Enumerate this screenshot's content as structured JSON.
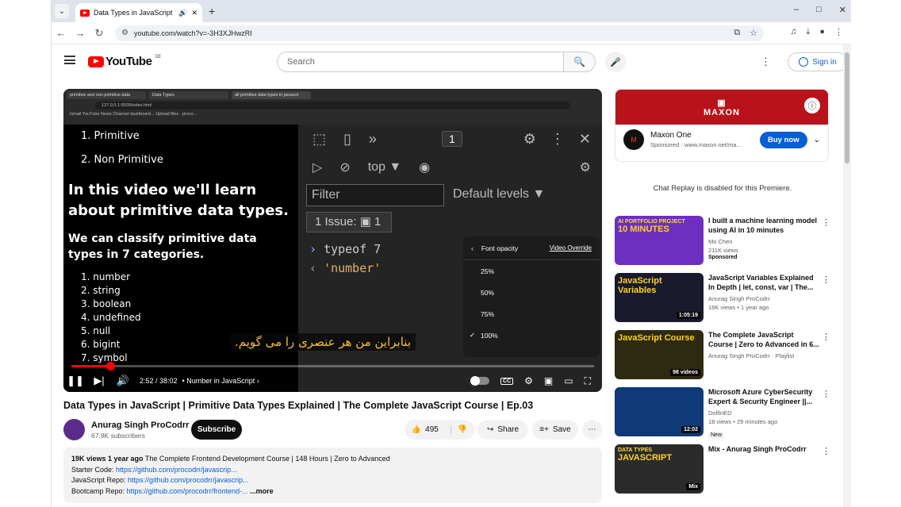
{
  "browser": {
    "tab_title": "Data Types in JavaScript | Pr",
    "url": "youtube.com/watch?v=-3H3XJHwzRI",
    "newtab": "+",
    "win": [
      "–",
      "□",
      "✕"
    ]
  },
  "header": {
    "logo": "YouTube",
    "region": "DE",
    "search_placeholder": "Search",
    "signin": "Sign in"
  },
  "video": {
    "browser_tabs": [
      "primitive and non primitive data",
      "Data Types",
      "all primitive data types in javascri"
    ],
    "inner_url": "127.0.0.1:5500/index.html",
    "bookmarks": "Gmail   YouTube   News   Channel dashboard...   Upload files · proco...",
    "list1": [
      "1. Primitive",
      "2. Non Primitive"
    ],
    "headline": "In this video we'll learn about primitive data types.",
    "classify": "We can classify primitive data types in 7 categories.",
    "categories": [
      "1. number",
      "2. string",
      "3. boolean",
      "4. undefined",
      "5. null",
      "6. bigint",
      "7. symbol"
    ],
    "devtools": {
      "badge_count": "1",
      "context": "top ▼",
      "filter": "Filter",
      "levels": "Default levels ▼",
      "issue": "1 Issue:  ▣ 1",
      "input": "typeof 7",
      "output": "'number'"
    },
    "menu": {
      "title": "Font opacity",
      "override": "Video Override",
      "items": [
        "25%",
        "50%",
        "75%",
        "100%"
      ],
      "selected_index": 3
    },
    "subtitle": "بنابراین من هر عنصری را می گویم.",
    "time": "2:52 / 38:02",
    "chapter": "• Number in JavaScript ›",
    "progress": 0.075
  },
  "meta": {
    "title": "Data Types in JavaScript | Primitive Data Types Explained | The Complete JavaScript Course | Ep.03",
    "channel": "Anurag Singh ProCodrr",
    "subscribers": "67.8K subscribers",
    "subscribe": "Subscribe",
    "likes": "495",
    "share": "Share",
    "save": "Save",
    "views": "19K views  1 year ago",
    "desc_line1": "The Complete Frontend Development Course | 148 Hours | Zero to Advanced",
    "desc_line2_label": "Starter Code: ",
    "desc_line2_link": "https://github.com/procodrr/javascrip...",
    "desc_line3_label": "JavaScript Repo: ",
    "desc_line3_link": "https://github.com/procodrr/javascrip...",
    "desc_line4_label": "Bootcamp Repo: ",
    "desc_line4_link": "https://github.com/procodrr/frontend-...",
    "more": "...more"
  },
  "ad": {
    "brand": "MAXON",
    "name": "Maxon One",
    "sponsored": "Sponsored · www.maxon.net/ma...",
    "cta": "Buy now"
  },
  "chat_replay": "Chat Replay is disabled for this Premiere.",
  "recs": [
    {
      "title": "I built a machine learning model using AI in 10 minutes",
      "channel": "Mo Chen",
      "meta": "211K views",
      "extra": "Sponsored",
      "thumb": "10 MINUTES",
      "thumb_top": "AI PORTFOLIO PROJECT",
      "color": "#6d2fbf"
    },
    {
      "title": "JavaScript Variables Explained In Depth | let, const, var | The...",
      "channel": "Anurag Singh ProCodrr",
      "meta": "18K views • 1 year ago",
      "extra": "",
      "thumb": "JavaScript Variables",
      "thumb_top": "",
      "dur": "1:05:19",
      "color": "#1a1a2e"
    },
    {
      "title": "The Complete JavaScript Course | Zero to Advanced in 6...",
      "channel": "Anurag Singh ProCodrr · Playlist",
      "meta": "",
      "extra": "",
      "thumb": "JavaScript Course",
      "thumb_top": "",
      "dur": "98 videos",
      "color": "#2d2a12"
    },
    {
      "title": "Microsoft Azure CyberSecurity Expert & Security Engineer ||...",
      "channel": "DolfinED",
      "meta": "18 views • 29 minutes ago",
      "extra": "New",
      "thumb": "",
      "thumb_top": "",
      "dur": "12:02",
      "color": "#0e3a78"
    },
    {
      "title": "Mix - Anurag Singh ProCodrr",
      "channel": "",
      "meta": "",
      "extra": "",
      "thumb": "JAVASCRIPT",
      "thumb_top": "DATA TYPES",
      "dur": "Mix",
      "color": "#2b2b2b"
    }
  ]
}
